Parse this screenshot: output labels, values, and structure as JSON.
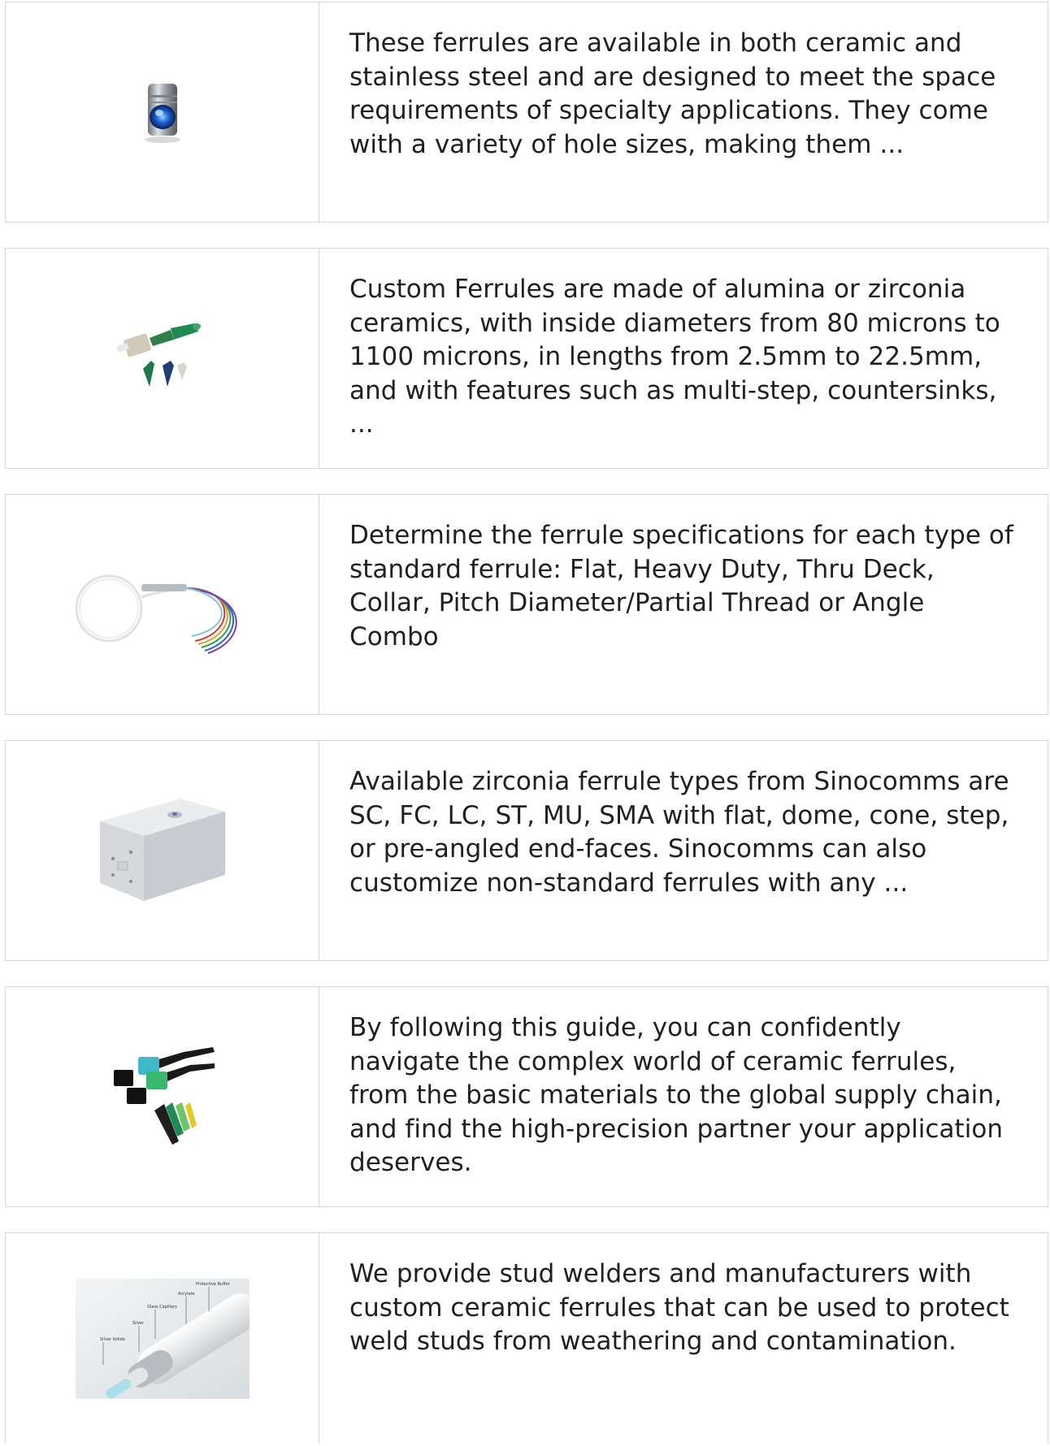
{
  "items": [
    {
      "image": "steel-ferrule-lens",
      "description": "These ferrules are available in both ceramic and stainless steel and are designed to meet the space requirements of specialty applications. They come with a variety of hole sizes, making them ..."
    },
    {
      "image": "lc-connector-parts",
      "description": "Custom Ferrules are made of alumina or zirconia ceramics, with inside diameters from 80 microns to 1100 microns, in lengths from 2.5mm to 22.5mm, and with features such as multi-step, countersinks, ..."
    },
    {
      "image": "fiber-splitter-pigtails",
      "description": "Determine the ferrule specifications for each type of standard ferrule: Flat, Heavy Duty, Thru Deck, Collar, Pitch Diameter/Partial Thread or Angle Combo"
    },
    {
      "image": "fiber-terminal-box",
      "description": "Available zirconia ferrule types from Sinocomms are SC, FC, LC, ST, MU, SMA with flat, dome, cone, step, or pre-angled end-faces. Sinocomms can also customize non-standard ferrules with any ..."
    },
    {
      "image": "mpo-connector-kit",
      "description": "By following this guide, you can confidently navigate the complex world of ceramic ferrules, from the basic materials to the global supply chain, and find the high-precision partner your application deserves."
    },
    {
      "image": "fiber-layer-diagram",
      "description": "We provide stud welders and manufacturers with custom ceramic ferrules that can be used to protect weld studs from weathering and contamination.",
      "diagram_labels": [
        "Protective Buffer",
        "Acrylate",
        "Glass Capillary",
        "Silver",
        "Silver Iodide"
      ]
    }
  ]
}
